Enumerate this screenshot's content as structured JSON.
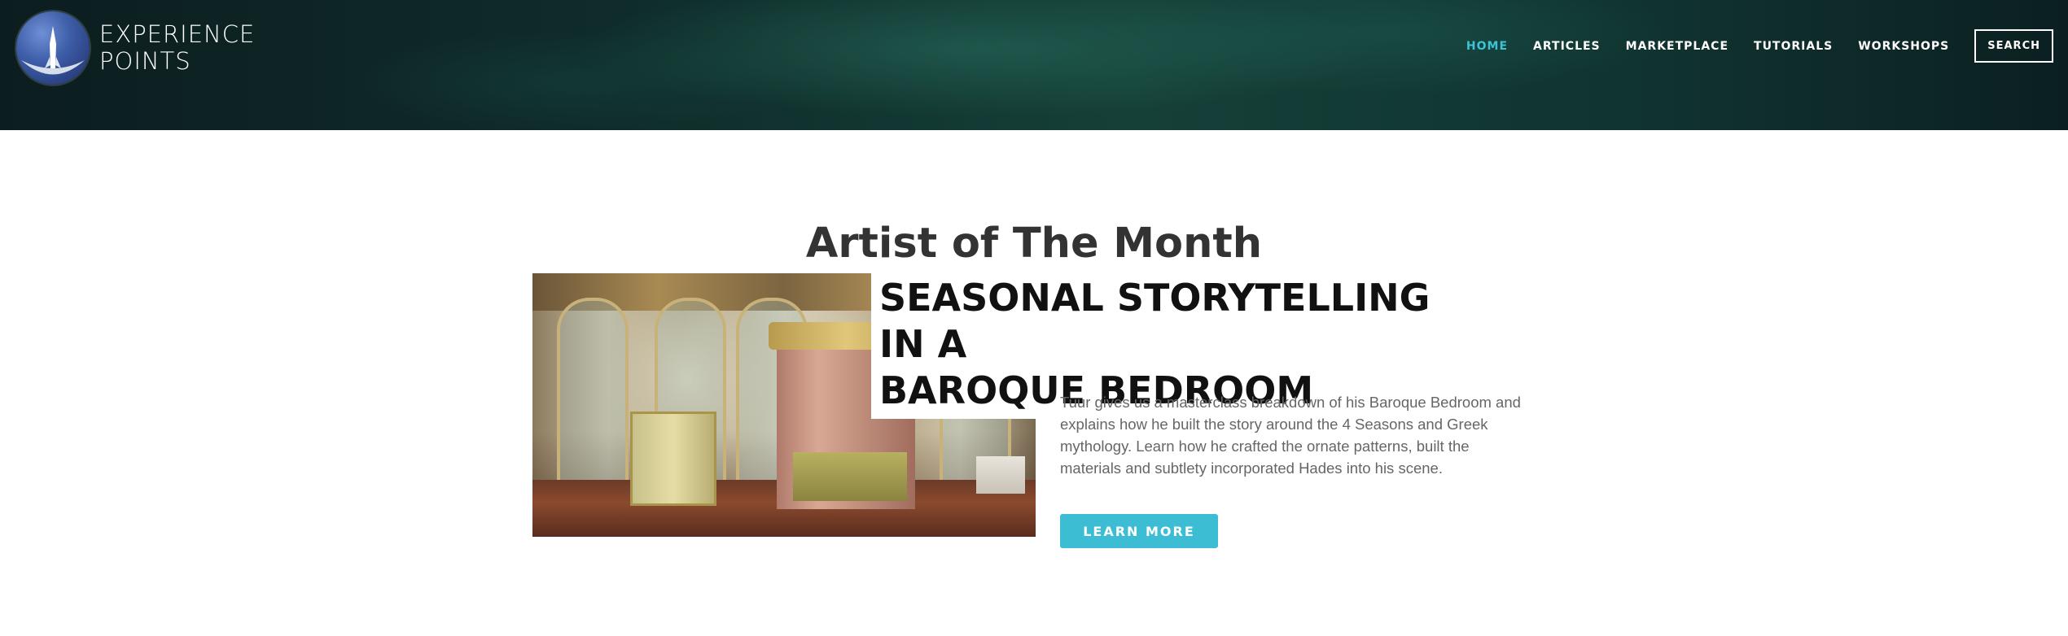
{
  "brand": {
    "name_line1": "EXPERIENCE",
    "name_line2": "POINTS"
  },
  "nav": {
    "items": [
      {
        "label": "HOME",
        "active": true
      },
      {
        "label": "ARTICLES",
        "active": false
      },
      {
        "label": "MARKETPLACE",
        "active": false
      },
      {
        "label": "TUTORIALS",
        "active": false
      },
      {
        "label": "WORKSHOPS",
        "active": false
      }
    ],
    "search_label": "SEARCH"
  },
  "section": {
    "title": "Artist of The Month"
  },
  "feature": {
    "title_line1": "SEASONAL STORYTELLING IN A",
    "title_line2": "BAROQUE BEDROOM",
    "description": "Tuur gives us a masterclass breakdown of his Baroque Bedroom and explains how he built the story around the 4 Seasons and Greek mythology. Learn how he crafted the ornate patterns, built the materials and subtlety incorporated Hades into his scene.",
    "cta_label": "LEARN MORE"
  },
  "colors": {
    "accent": "#3cbdd4",
    "active_nav": "#3cc3d6",
    "header_bg": "#0f2c2a",
    "title_text": "#333333"
  },
  "icons": {
    "logo": "rocket-globe-icon"
  }
}
